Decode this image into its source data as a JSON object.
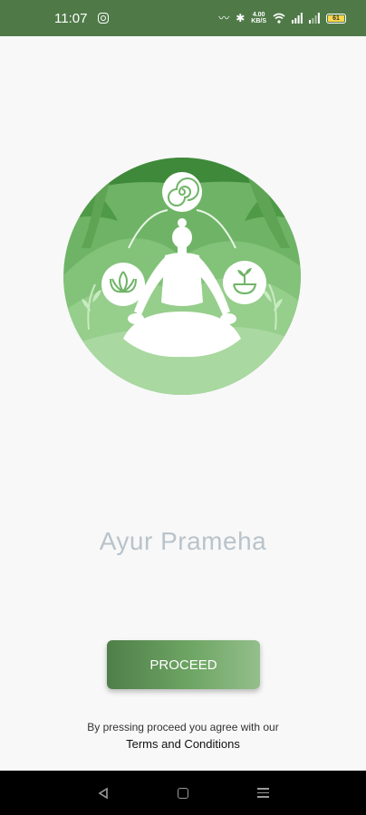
{
  "status_bar": {
    "time": "11:07",
    "net_speed_value": "4.00",
    "net_speed_unit": "KB/S",
    "battery_level": "61"
  },
  "app": {
    "title": "Ayur Prameha"
  },
  "actions": {
    "proceed_label": "PROCEED"
  },
  "legal": {
    "agree_text": "By pressing proceed you agree with our",
    "terms_label": "Terms and Conditions"
  },
  "colors": {
    "status_bar": "#4f7a48",
    "brand_green": "#6ea564",
    "title_gray": "#b9c3cb"
  },
  "icons": {
    "nav_back": "back-triangle-icon",
    "nav_home": "home-square-icon",
    "nav_recents": "menu-lines-icon"
  }
}
